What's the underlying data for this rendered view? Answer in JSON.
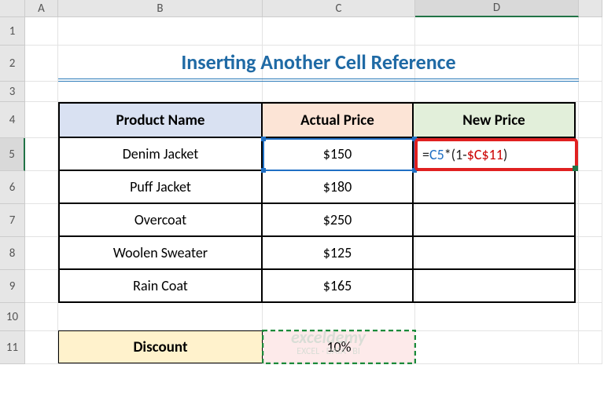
{
  "columns": [
    "A",
    "B",
    "C",
    "D"
  ],
  "title": "Inserting Another Cell Reference",
  "headers": {
    "b": "Product Name",
    "c": "Actual Price",
    "d": "New Price"
  },
  "rows": [
    {
      "name": "Denim Jacket",
      "price": "$150"
    },
    {
      "name": "Puff Jacket",
      "price": "$180"
    },
    {
      "name": "Overcoat",
      "price": "$250"
    },
    {
      "name": "Woolen Sweater",
      "price": "$125"
    },
    {
      "name": "Rain Coat",
      "price": "$165"
    }
  ],
  "discount": {
    "label": "Discount",
    "value": "10%"
  },
  "formula": {
    "eq": "=",
    "ref1": "C5",
    "mid": "*(1-",
    "ref2": "$C$11",
    "end": ")"
  },
  "active": {
    "col": "D",
    "row": 5
  },
  "watermark": {
    "brand": "exceldemy",
    "tag": "EXCEL · DATA · BI"
  },
  "chart_data": {
    "type": "table",
    "title": "Inserting Another Cell Reference",
    "columns": [
      "Product Name",
      "Actual Price",
      "New Price"
    ],
    "rows": [
      [
        "Denim Jacket",
        150,
        null
      ],
      [
        "Puff Jacket",
        180,
        null
      ],
      [
        "Overcoat",
        250,
        null
      ],
      [
        "Woolen Sweater",
        125,
        null
      ],
      [
        "Rain Coat",
        165,
        null
      ]
    ],
    "discount_pct": 10,
    "formula_d5": "=C5*(1-$C$11)"
  }
}
